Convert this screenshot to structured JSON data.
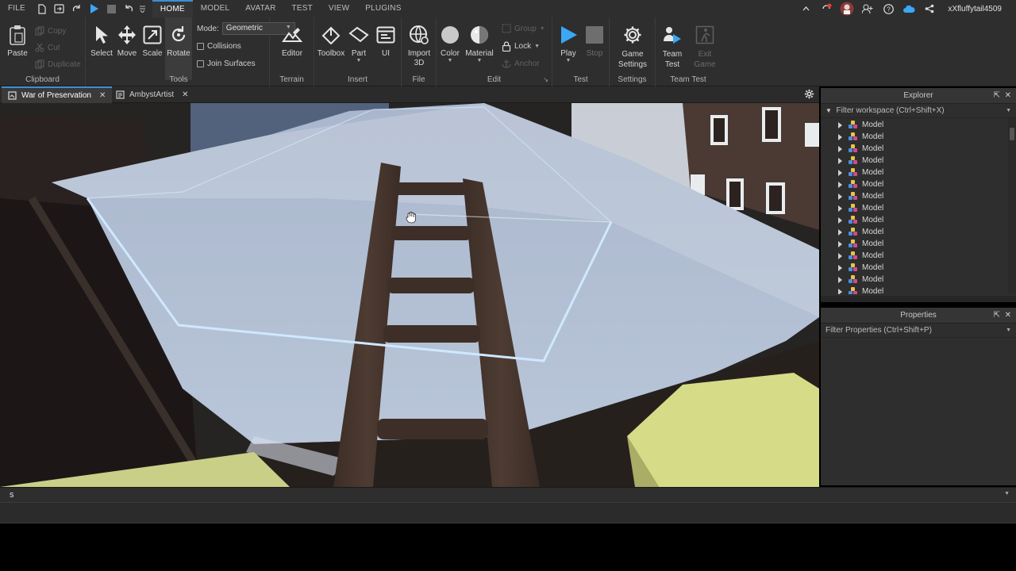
{
  "menubar": {
    "file": "FILE",
    "tabs": [
      "HOME",
      "MODEL",
      "AVATAR",
      "TEST",
      "VIEW",
      "PLUGINS"
    ],
    "active_tab": "HOME",
    "username": "xXfluffytail4509"
  },
  "ribbon": {
    "clipboard": {
      "label": "Clipboard",
      "paste": "Paste",
      "copy": "Copy",
      "cut": "Cut",
      "duplicate": "Duplicate"
    },
    "tools": {
      "label": "Tools",
      "select": "Select",
      "move": "Move",
      "scale": "Scale",
      "rotate": "Rotate",
      "mode_label": "Mode:",
      "mode_value": "Geometric",
      "collisions": "Collisions",
      "join_surfaces": "Join Surfaces"
    },
    "terrain": {
      "label": "Terrain",
      "editor": "Editor"
    },
    "insert": {
      "label": "Insert",
      "toolbox": "Toolbox",
      "part": "Part",
      "ui": "UI"
    },
    "file": {
      "label": "File",
      "import3d": "Import 3D"
    },
    "edit": {
      "label": "Edit",
      "color": "Color",
      "material": "Material",
      "group": "Group",
      "lock": "Lock",
      "anchor": "Anchor"
    },
    "test": {
      "label": "Test",
      "play": "Play",
      "stop": "Stop"
    },
    "settings": {
      "label": "Settings",
      "game_settings": "Game Settings"
    },
    "team_test": {
      "label": "Team Test",
      "team_test": "Team Test",
      "exit_game": "Exit Game"
    }
  },
  "doc_tabs": [
    {
      "title": "War of Preservation",
      "active": true
    },
    {
      "title": "AmbystArtist",
      "active": false
    }
  ],
  "explorer": {
    "title": "Explorer",
    "filter_placeholder": "Filter workspace (Ctrl+Shift+X)",
    "items": [
      "Model",
      "Model",
      "Model",
      "Model",
      "Model",
      "Model",
      "Model",
      "Model",
      "Model",
      "Model",
      "Model",
      "Model",
      "Model",
      "Model",
      "Model"
    ]
  },
  "properties": {
    "title": "Properties",
    "filter_placeholder": "Filter Properties (Ctrl+Shift+P)"
  },
  "command_bar": {
    "value": "s"
  },
  "colors": {
    "chrome": "#2e2e2e",
    "accent": "#3b8fd9",
    "selection_outline": "#cfe8ff"
  }
}
